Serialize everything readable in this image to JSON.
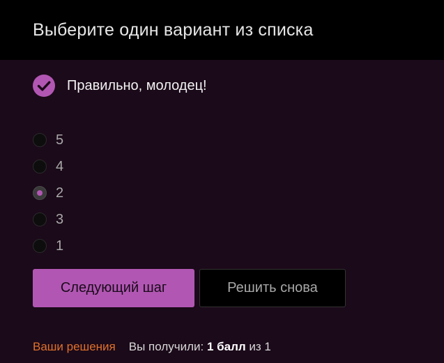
{
  "header": {
    "title": "Выберите один вариант из списка"
  },
  "feedback": {
    "icon": "checkmark-circle-icon",
    "text": "Правильно, молодец!"
  },
  "options": [
    {
      "label": "5",
      "checked": false
    },
    {
      "label": "4",
      "checked": false
    },
    {
      "label": "2",
      "checked": true
    },
    {
      "label": "3",
      "checked": false
    },
    {
      "label": "1",
      "checked": false
    }
  ],
  "buttons": {
    "next_label": "Следующий шаг",
    "retry_label": "Решить снова"
  },
  "footer": {
    "solutions_link": "Ваши решения",
    "score_prefix": "Вы получили: ",
    "score_value": "1 балл",
    "score_suffix": " из 1"
  },
  "colors": {
    "accent": "#b157b3",
    "background": "#1b0a1a",
    "header_bg": "#000000",
    "link": "#e0702a"
  }
}
